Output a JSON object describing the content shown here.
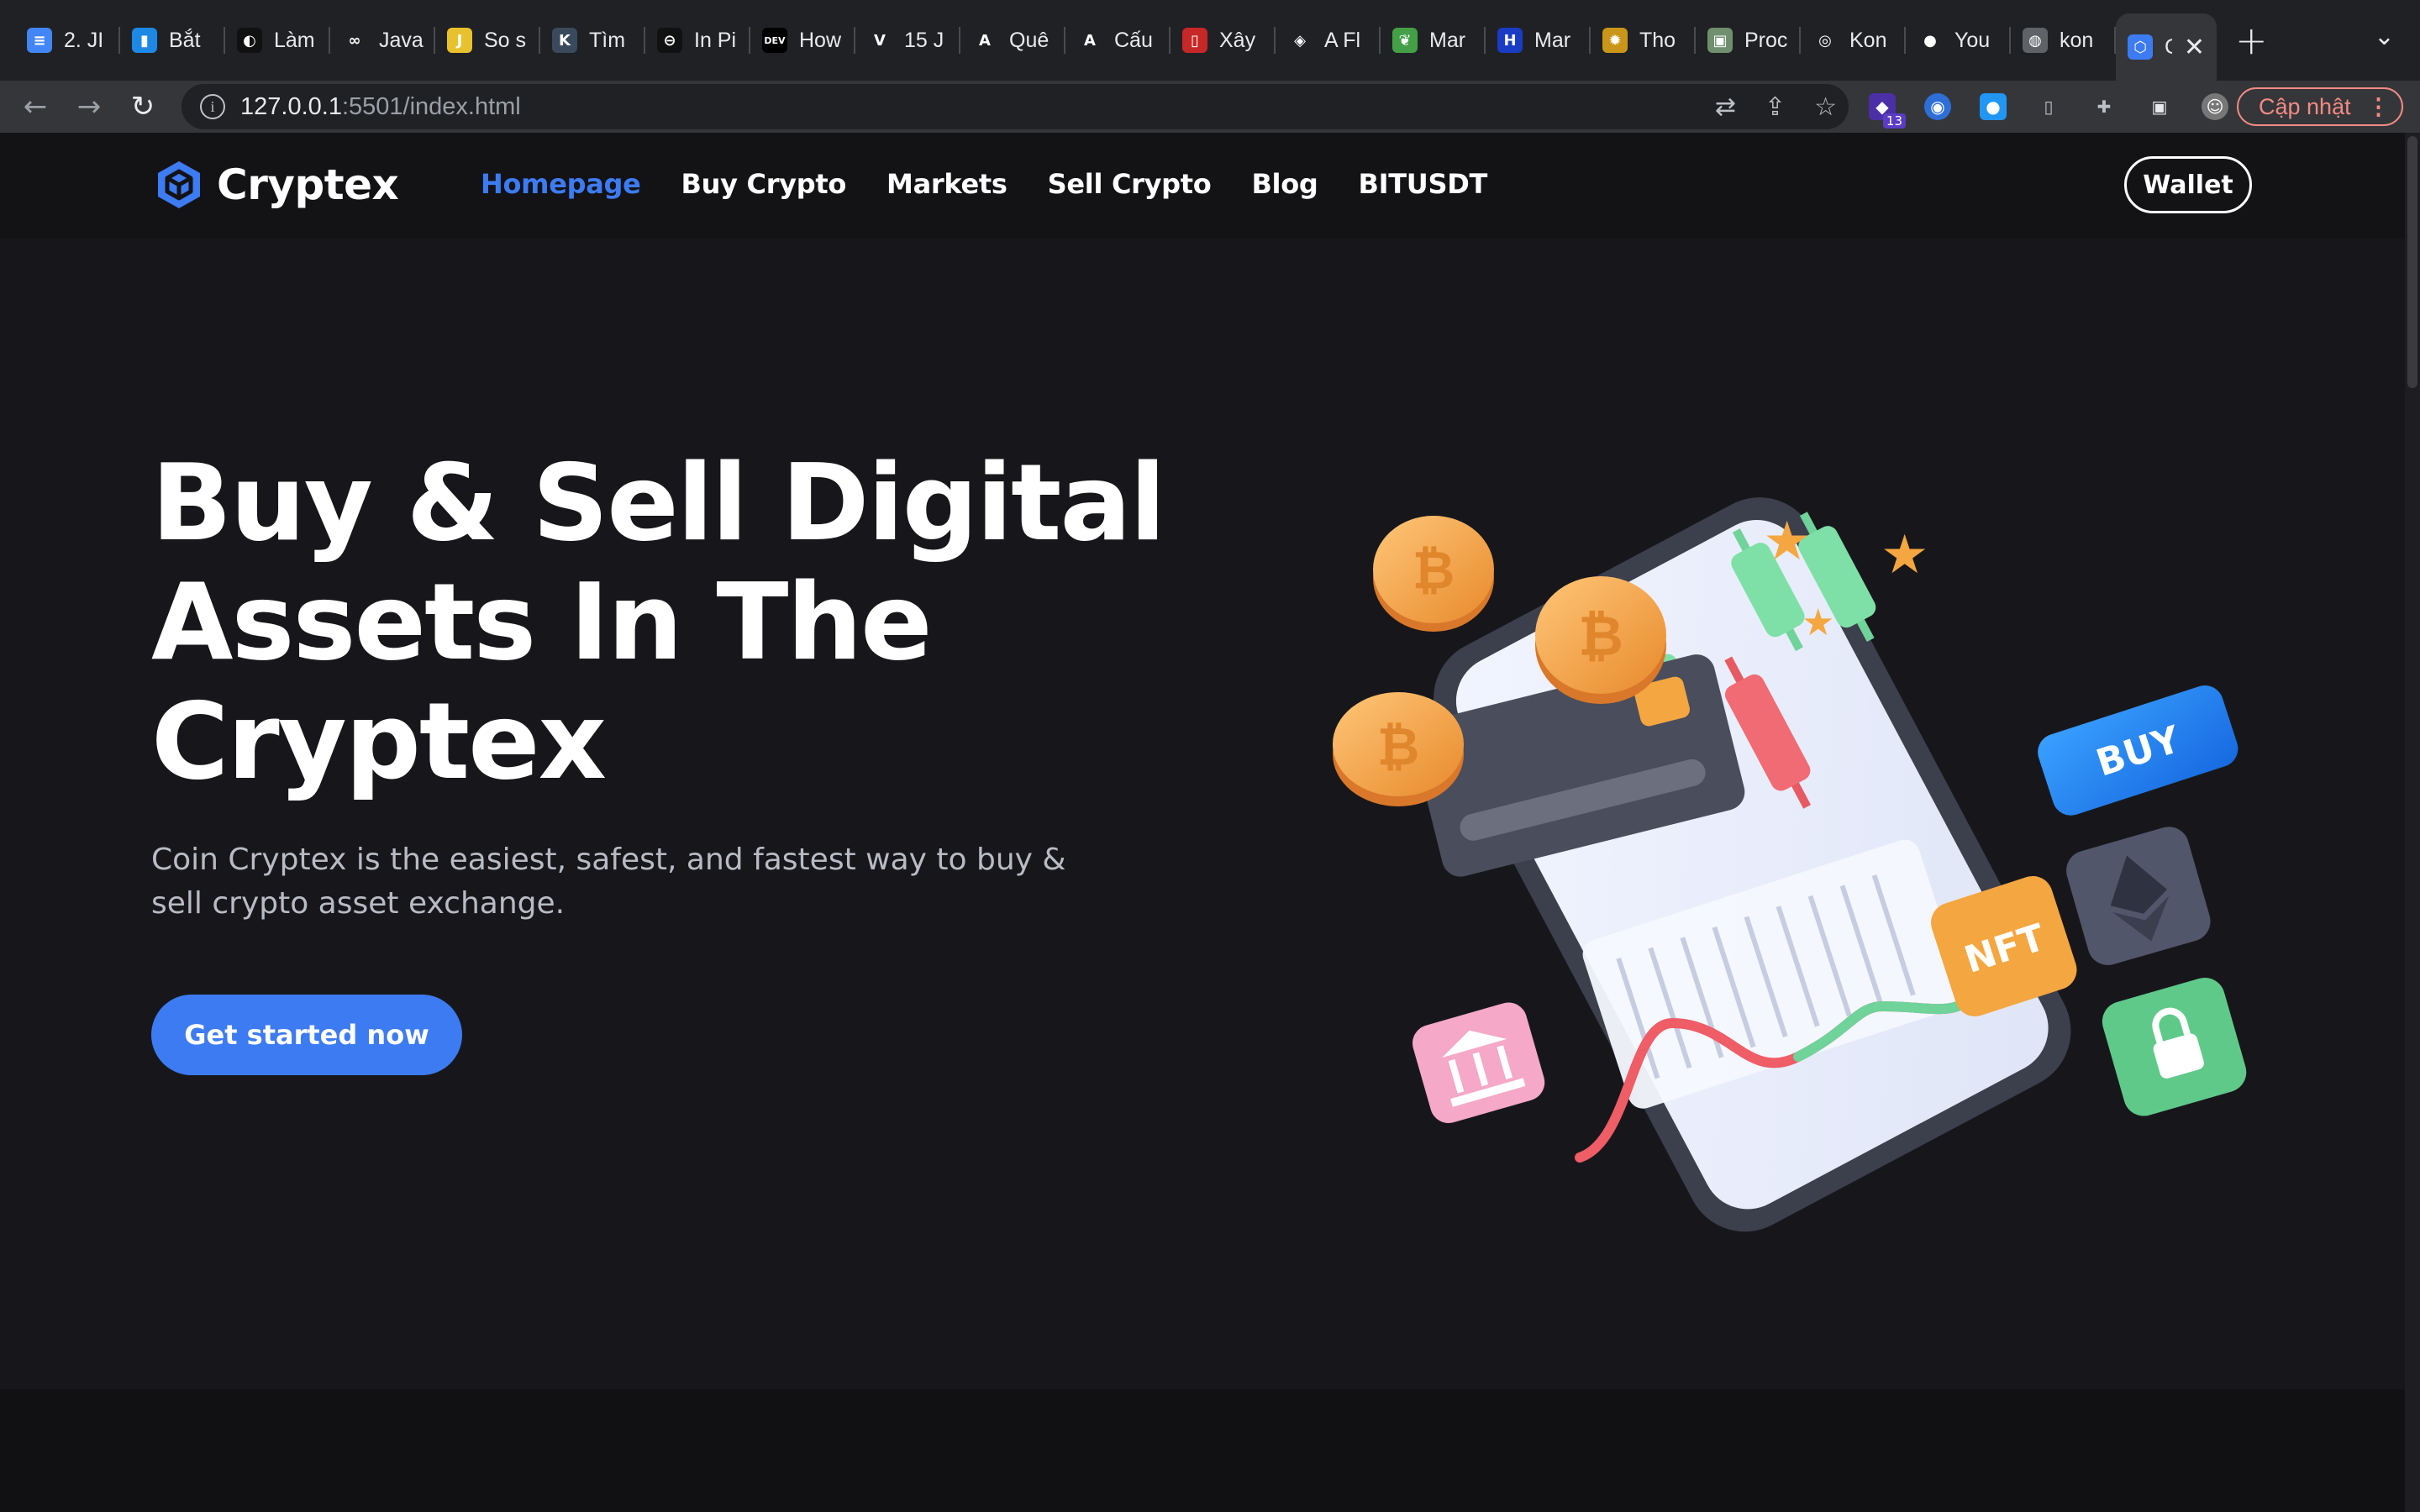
{
  "browser": {
    "tabs": [
      {
        "title": "2. JI",
        "icon": "docs-icon",
        "color": "#4285f4",
        "glyph": "≡"
      },
      {
        "title": "Bắt",
        "icon": "bookmark-icon",
        "color": "#1e88e5",
        "glyph": "▮"
      },
      {
        "title": "Làm",
        "icon": "circle-logo-icon",
        "color": "#111",
        "glyph": "◐"
      },
      {
        "title": "Java",
        "icon": "infinity-icon",
        "color": "#202124",
        "glyph": "∞"
      },
      {
        "title": "So s",
        "icon": "js-icon",
        "color": "#e8c22c",
        "glyph": "J"
      },
      {
        "title": "Tìm",
        "icon": "k-icon",
        "color": "#3a4a5c",
        "glyph": "K"
      },
      {
        "title": "In Pi",
        "icon": "globe-dark-icon",
        "color": "#111",
        "glyph": "⊖"
      },
      {
        "title": "How",
        "icon": "dev-icon",
        "color": "#000",
        "glyph": "DEV"
      },
      {
        "title": "15 J",
        "icon": "vuetify-icon",
        "color": "#202124",
        "glyph": "V"
      },
      {
        "title": "Quê",
        "icon": "a-icon",
        "color": "#202124",
        "glyph": "A"
      },
      {
        "title": "Cấu",
        "icon": "a-icon",
        "color": "#202124",
        "glyph": "A"
      },
      {
        "title": "Xây",
        "icon": "red-icon",
        "color": "#c62828",
        "glyph": "▯"
      },
      {
        "title": "A Fl",
        "icon": "codepen-icon",
        "color": "#202124",
        "glyph": "◈"
      },
      {
        "title": "Mar",
        "icon": "leaf-icon",
        "color": "#43a047",
        "glyph": "❦"
      },
      {
        "title": "Mar",
        "icon": "h-icon",
        "color": "#1a3cc4",
        "glyph": "H"
      },
      {
        "title": "Tho",
        "icon": "sunflower-icon",
        "color": "#c9961a",
        "glyph": "✹"
      },
      {
        "title": "Proc",
        "icon": "photo-icon",
        "color": "#6f8f6f",
        "glyph": "▣"
      },
      {
        "title": "Kon",
        "icon": "circle-icon",
        "color": "#202124",
        "glyph": "◎"
      },
      {
        "title": "You",
        "icon": "github-icon",
        "color": "#202124",
        "glyph": "●"
      },
      {
        "title": "kon",
        "icon": "globe-icon",
        "color": "#5f6368",
        "glyph": "◍"
      },
      {
        "title": "C",
        "icon": "cryptex-icon",
        "color": "#3d7bf2",
        "glyph": "⬡",
        "active": true
      }
    ],
    "new_tab": "+",
    "tab_menu": "⌄",
    "url_host": "127.0.0.1",
    "url_path": ":5501/index.html",
    "update_label": "Cập nhật",
    "ext_badge": "13"
  },
  "site": {
    "brand": "Cryptex",
    "nav": [
      "Homepage",
      "Buy Crypto",
      "Markets",
      "Sell Crypto",
      "Blog",
      "BITUSDT"
    ],
    "wallet_label": "Wallet",
    "hero_title": "Buy & Sell Digital Assets In The Cryptex",
    "hero_subtitle": "Coin Cryptex is the easiest, safest, and fastest way to buy & sell crypto asset exchange.",
    "cta_label": "Get started now",
    "illustration": {
      "buy_tile": "BUY",
      "nft_tile": "NFT",
      "coin_symbol": "₿"
    },
    "colors": {
      "accent": "#3d7bf2",
      "background": "#17171b",
      "nav_bg": "#131316"
    }
  }
}
